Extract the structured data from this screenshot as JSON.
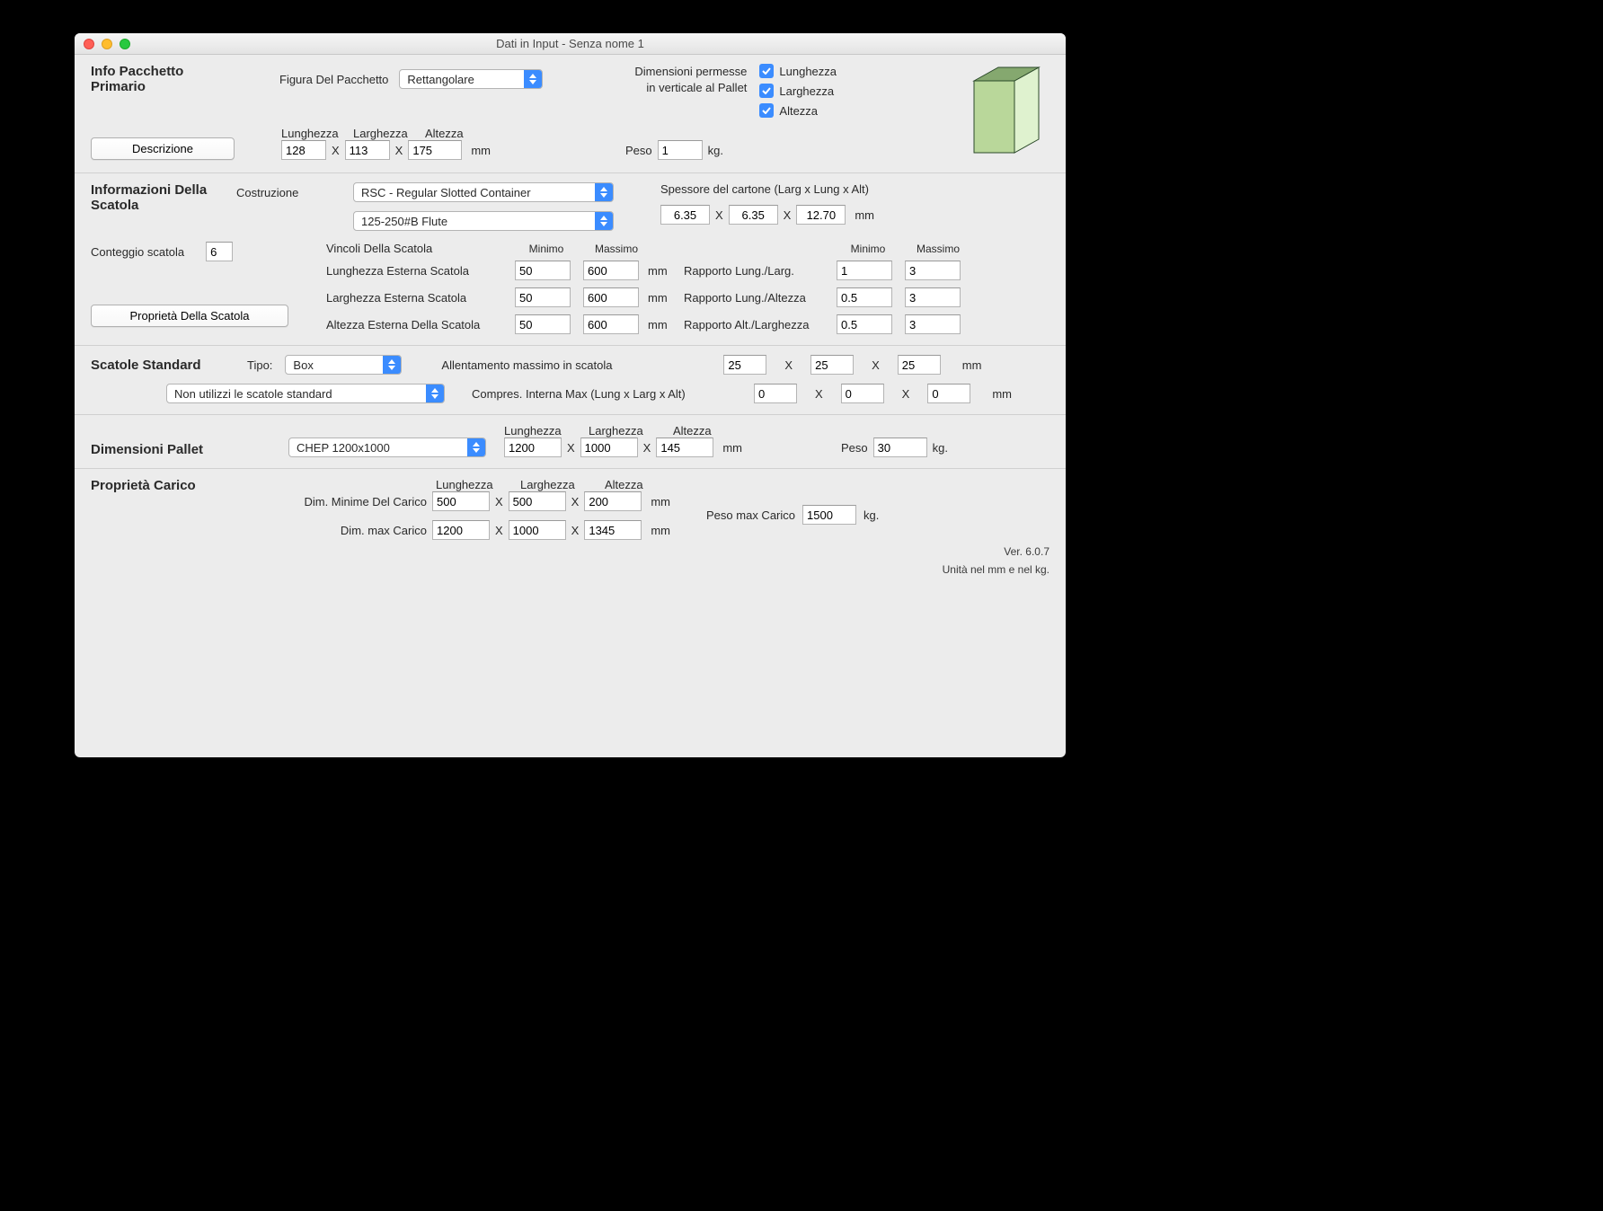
{
  "window_title": "Dati in Input - Senza nome 1",
  "pkg": {
    "title": "Info Pacchetto Primario",
    "shape_label": "Figura Del Pacchetto",
    "shape_value": "Rettangolare",
    "allowed_title_l1": "Dimensioni permesse",
    "allowed_title_l2": "in verticale al Pallet",
    "chk_length": "Lunghezza",
    "chk_width": "Larghezza",
    "chk_height": "Altezza",
    "btn_desc": "Descrizione",
    "dim_length_hdr": "Lunghezza",
    "dim_width_hdr": "Larghezza",
    "dim_height_hdr": "Altezza",
    "dim_length": "128",
    "dim_width": "113",
    "dim_height": "175",
    "dim_unit": "mm",
    "weight_label": "Peso",
    "weight_val": "1",
    "weight_unit": "kg."
  },
  "box": {
    "title": "Informazioni Della Scatola",
    "constr_label": "Costruzione",
    "constr_value": "RSC - Regular Slotted Container",
    "flute_value": "125-250#B Flute",
    "thickness_label": "Spessore del cartone (Larg x Lung x Alt)",
    "thk_w": "6.35",
    "thk_l": "6.35",
    "thk_h": "12.70",
    "thk_unit": "mm",
    "count_label": "Conteggio scatola",
    "count_val": "6",
    "btn_props": "Proprietà Della Scatola",
    "constraints_title": "Vincoli Della Scatola",
    "col_min": "Minimo",
    "col_max": "Massimo",
    "row_ext_len": "Lunghezza Esterna Scatola",
    "row_ext_wid": "Larghezza Esterna Scatola",
    "row_ext_hgt": "Altezza Esterna Della Scatola",
    "ext_len_min": "50",
    "ext_len_max": "600",
    "ext_wid_min": "50",
    "ext_wid_max": "600",
    "ext_hgt_min": "50",
    "ext_hgt_max": "600",
    "unit": "mm",
    "ratio_ll": "Rapporto Lung./Larg.",
    "ratio_la": "Rapporto Lung./Altezza",
    "ratio_al": "Rapporto Alt./Larghezza",
    "r_ll_min": "1",
    "r_ll_max": "3",
    "r_la_min": "0.5",
    "r_la_max": "3",
    "r_al_min": "0.5",
    "r_al_max": "3"
  },
  "std": {
    "title": "Scatole Standard",
    "type_label": "Tipo:",
    "type_value": "Box",
    "use_value": "Non utilizzi le scatole standard",
    "slack_label": "Allentamento massimo in scatola",
    "slack_x": "25",
    "slack_y": "25",
    "slack_z": "25",
    "comp_label": "Compres. Interna Max (Lung x Larg x Alt)",
    "comp_x": "0",
    "comp_y": "0",
    "comp_z": "0",
    "unit": "mm"
  },
  "pallet": {
    "title": "Dimensioni Pallet",
    "sel_value": "CHEP 1200x1000",
    "hdr_l": "Lunghezza",
    "hdr_w": "Larghezza",
    "hdr_h": "Altezza",
    "l": "1200",
    "w": "1000",
    "h": "145",
    "unit": "mm",
    "weight_label": "Peso",
    "weight_val": "30",
    "weight_unit": "kg."
  },
  "load": {
    "title": "Proprietà Carico",
    "hdr_l": "Lunghezza",
    "hdr_w": "Larghezza",
    "hdr_h": "Altezza",
    "min_label": "Dim. Minime Del Carico",
    "max_label": "Dim. max Carico",
    "min_l": "500",
    "min_w": "500",
    "min_h": "200",
    "max_l": "1200",
    "max_w": "1000",
    "max_h": "1345",
    "unit": "mm",
    "maxw_label": "Peso max Carico",
    "maxw_val": "1500",
    "maxw_unit": "kg."
  },
  "footer": {
    "version": "Ver. 6.0.7",
    "units": "Unità nel mm e nel kg."
  }
}
